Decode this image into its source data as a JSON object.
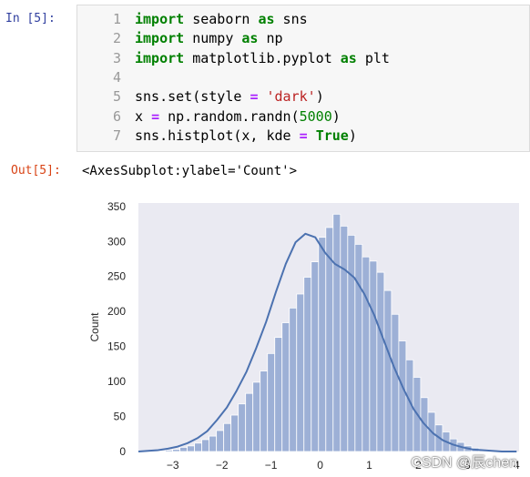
{
  "cell": {
    "in_prompt": "In  [5]:",
    "out_prompt": "Out[5]:",
    "output_text": "<AxesSubplot:ylabel='Count'>",
    "lines": [
      {
        "n": "1",
        "tokens": [
          {
            "t": "import",
            "c": "kw"
          },
          {
            "t": " seaborn ",
            "c": "txt"
          },
          {
            "t": "as",
            "c": "kw"
          },
          {
            "t": " sns",
            "c": "txt"
          }
        ]
      },
      {
        "n": "2",
        "tokens": [
          {
            "t": "import",
            "c": "kw"
          },
          {
            "t": " numpy ",
            "c": "txt"
          },
          {
            "t": "as",
            "c": "kw"
          },
          {
            "t": " np",
            "c": "txt"
          }
        ]
      },
      {
        "n": "3",
        "tokens": [
          {
            "t": "import",
            "c": "kw"
          },
          {
            "t": " matplotlib.pyplot ",
            "c": "txt"
          },
          {
            "t": "as",
            "c": "kw"
          },
          {
            "t": " plt",
            "c": "txt"
          }
        ]
      },
      {
        "n": "4",
        "tokens": []
      },
      {
        "n": "5",
        "tokens": [
          {
            "t": "sns.set(style ",
            "c": "txt"
          },
          {
            "t": "=",
            "c": "op"
          },
          {
            "t": " ",
            "c": "txt"
          },
          {
            "t": "'dark'",
            "c": "str"
          },
          {
            "t": ")",
            "c": "txt"
          }
        ]
      },
      {
        "n": "6",
        "tokens": [
          {
            "t": "x ",
            "c": "txt"
          },
          {
            "t": "=",
            "c": "op"
          },
          {
            "t": " np.random.randn(",
            "c": "txt"
          },
          {
            "t": "5000",
            "c": "num"
          },
          {
            "t": ")",
            "c": "txt"
          }
        ]
      },
      {
        "n": "7",
        "tokens": [
          {
            "t": "sns.histplot(x, kde ",
            "c": "txt"
          },
          {
            "t": "=",
            "c": "op"
          },
          {
            "t": " ",
            "c": "txt"
          },
          {
            "t": "True",
            "c": "kw"
          },
          {
            "t": ")",
            "c": "txt"
          }
        ]
      }
    ]
  },
  "watermark": "CSDN @辰chen",
  "colors": {
    "plot_bg": "#eaeaf2",
    "bar_fill": "#9db0d6",
    "bar_edge": "#ffffff",
    "kde_line": "#4c72b0"
  },
  "chart_data": {
    "type": "bar",
    "xlabel": "",
    "ylabel": "Count",
    "xlim": [
      -3.7,
      4.05
    ],
    "ylim": [
      0,
      355
    ],
    "xticks": [
      -3,
      -2,
      -1,
      0,
      1,
      2,
      3,
      4
    ],
    "yticks": [
      0,
      50,
      100,
      150,
      200,
      250,
      300,
      350
    ],
    "bin_edges_start": -3.3,
    "bin_width": 0.1485,
    "counts": [
      1,
      2,
      3,
      6,
      8,
      12,
      17,
      22,
      30,
      40,
      52,
      68,
      83,
      99,
      115,
      140,
      163,
      184,
      205,
      225,
      249,
      271,
      306,
      320,
      339,
      322,
      309,
      296,
      278,
      272,
      256,
      230,
      196,
      158,
      131,
      106,
      77,
      56,
      38,
      28,
      18,
      13,
      8,
      5,
      2,
      1
    ],
    "kde": {
      "x": [
        -3.7,
        -3.5,
        -3.3,
        -3.1,
        -2.9,
        -2.7,
        -2.5,
        -2.3,
        -2.1,
        -1.9,
        -1.7,
        -1.5,
        -1.3,
        -1.1,
        -0.9,
        -0.7,
        -0.5,
        -0.3,
        -0.1,
        0.1,
        0.3,
        0.5,
        0.7,
        0.9,
        1.1,
        1.3,
        1.5,
        1.7,
        1.9,
        2.1,
        2.3,
        2.5,
        2.7,
        2.9,
        3.1,
        3.3,
        3.5,
        3.7,
        4.0
      ],
      "y": [
        0,
        1,
        2,
        4,
        7,
        12,
        19,
        29,
        45,
        63,
        87,
        114,
        148,
        185,
        228,
        268,
        299,
        311,
        306,
        284,
        268,
        260,
        248,
        225,
        195,
        158,
        121,
        89,
        61,
        41,
        26,
        16,
        10,
        6,
        3,
        2,
        1,
        0,
        0
      ]
    }
  }
}
